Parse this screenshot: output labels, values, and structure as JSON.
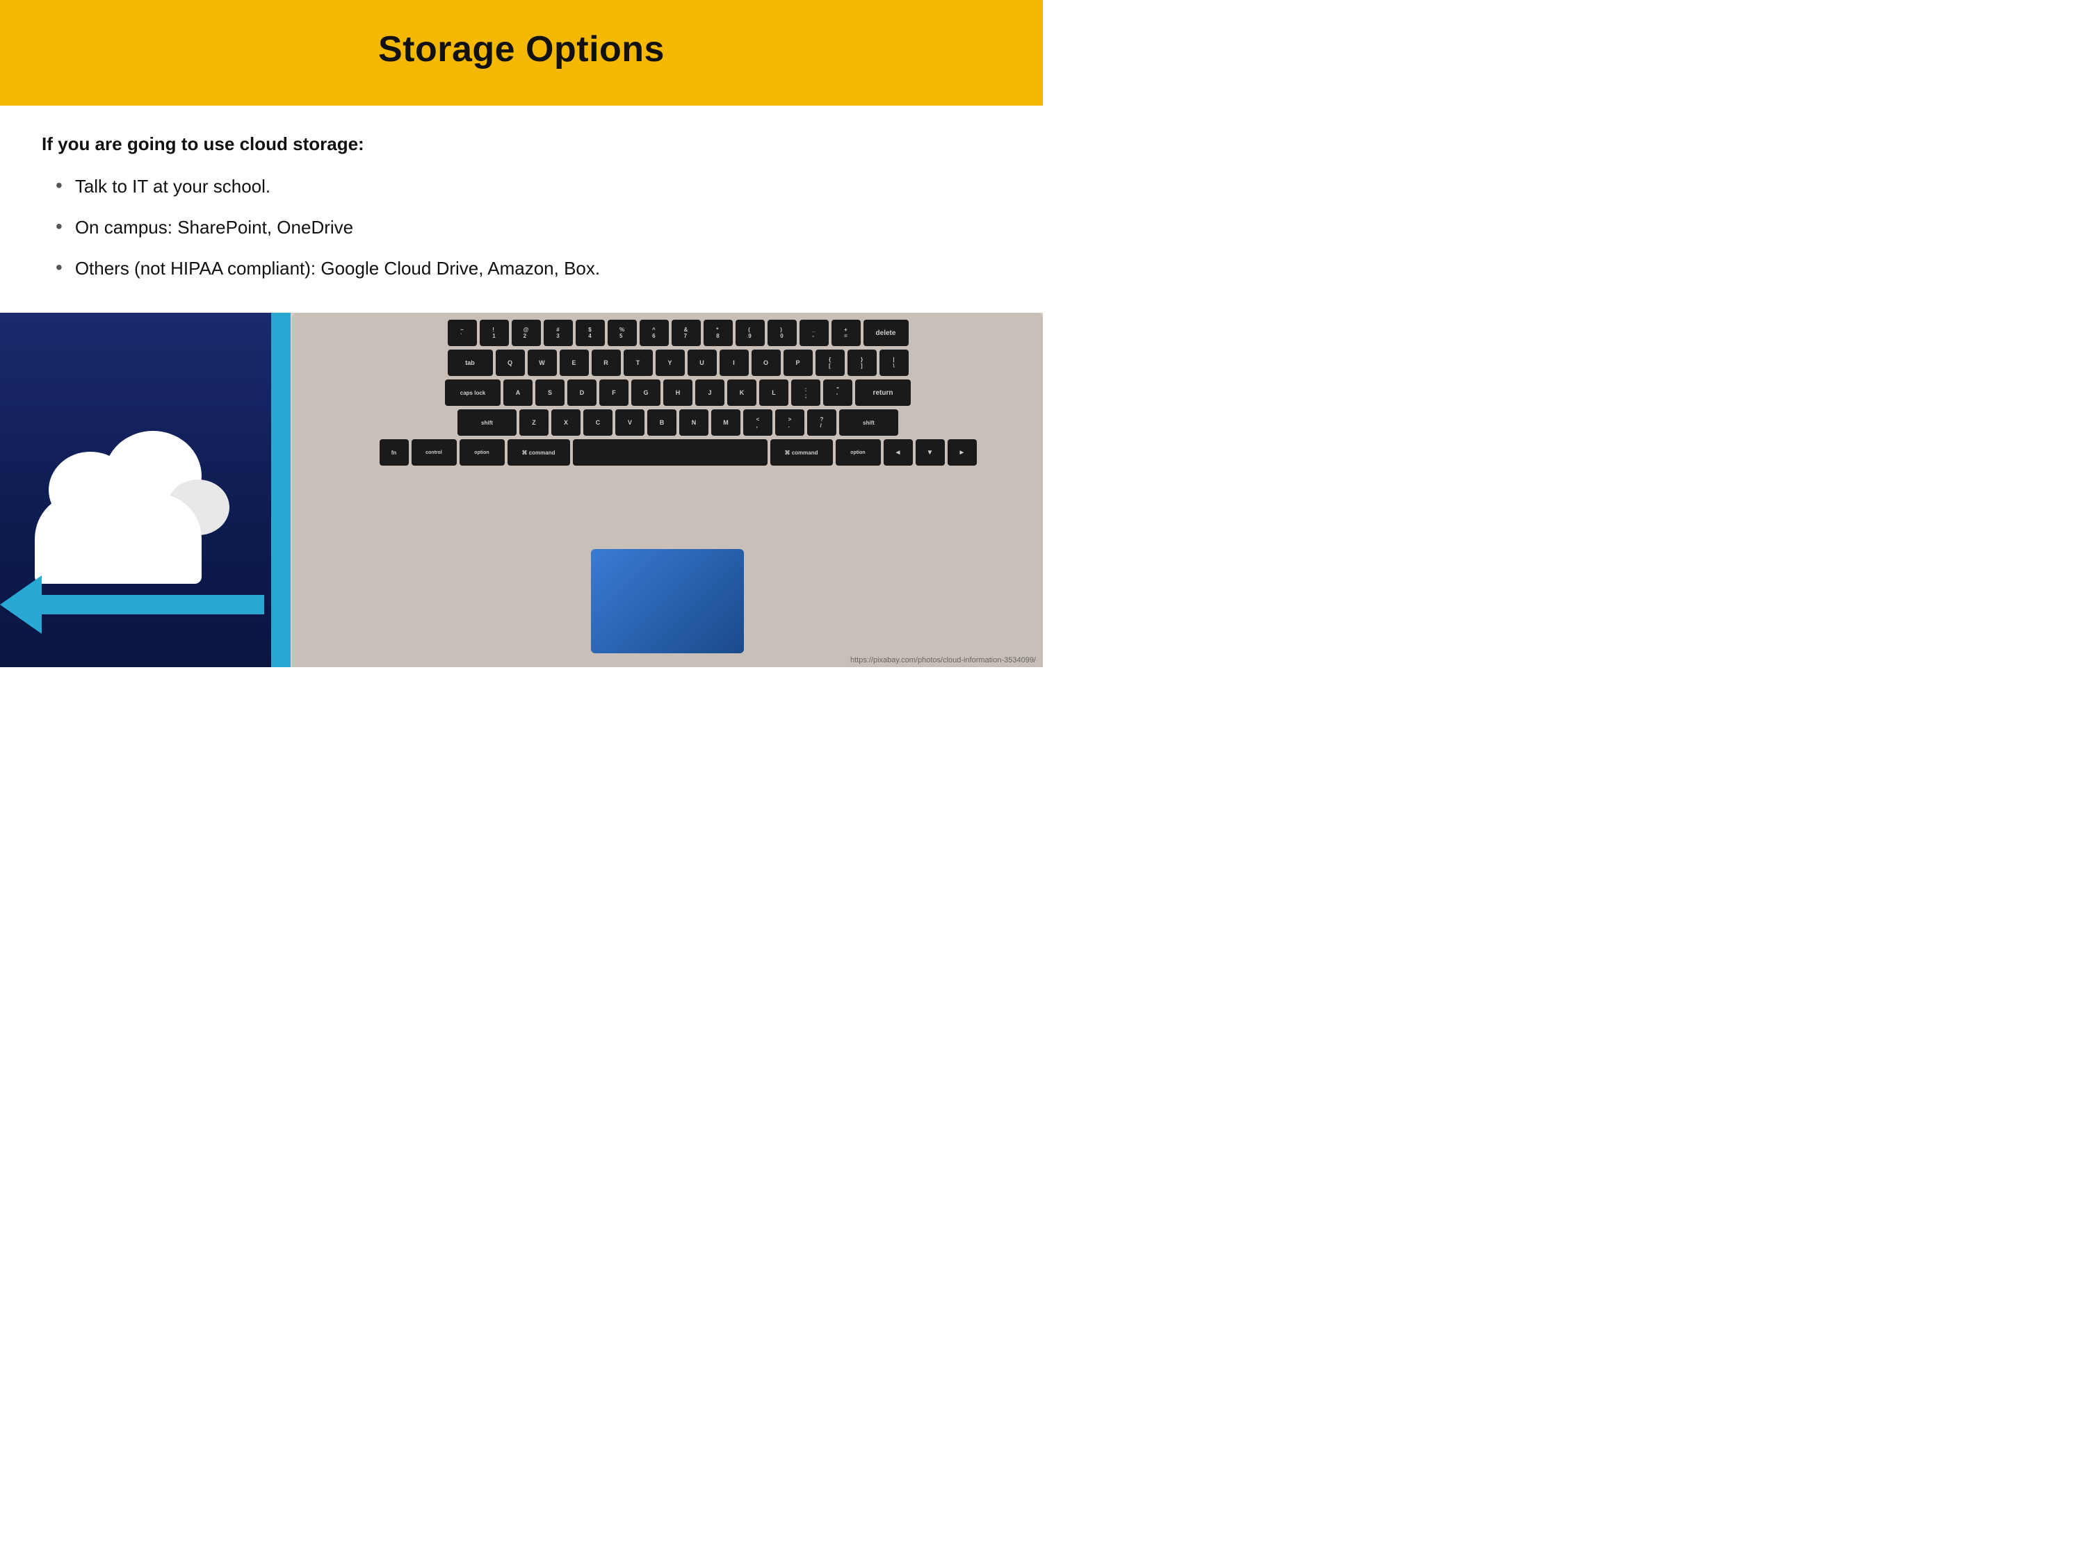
{
  "header": {
    "title": "Storage Options",
    "background_color": "#F5B800"
  },
  "content": {
    "intro": "If you are going to use cloud storage:",
    "bullets": [
      {
        "id": 1,
        "text": "Talk to IT at your school."
      },
      {
        "id": 2,
        "text": "On campus: SharePoint, OneDrive"
      },
      {
        "id": 3,
        "text": "Others (not HIPAA compliant): Google Cloud Drive, Amazon, Box."
      }
    ]
  },
  "keyboard_keys": {
    "row1": [
      "~\n`",
      "!\n1",
      "@\n2",
      "#\n3",
      "$\n4",
      "%\n5",
      "^\n6",
      "&\n7",
      "*\n8",
      "(\n9",
      ")\n0",
      "_\n-",
      "+\n="
    ],
    "row2": [
      "Q",
      "W",
      "E",
      "R",
      "T",
      "Y",
      "U",
      "I",
      "O",
      "P",
      "{\n[",
      "}\n]",
      "|\n\\"
    ],
    "row3": [
      "A",
      "S",
      "D",
      "F",
      "G",
      "H",
      "J",
      "K",
      "L",
      ":\n;",
      "\"\n'"
    ],
    "row4": [
      "Z",
      "X",
      "C",
      "V",
      "B",
      "N",
      "M",
      "<\n,",
      ">\n.",
      "?\n/"
    ],
    "row5": [
      "fn",
      "control",
      "option",
      "command",
      "",
      "command",
      "option",
      "◄",
      "▼",
      "►"
    ]
  },
  "footer": {
    "url": "https://pixabay.com/photos/cloud-information-3534099/"
  }
}
